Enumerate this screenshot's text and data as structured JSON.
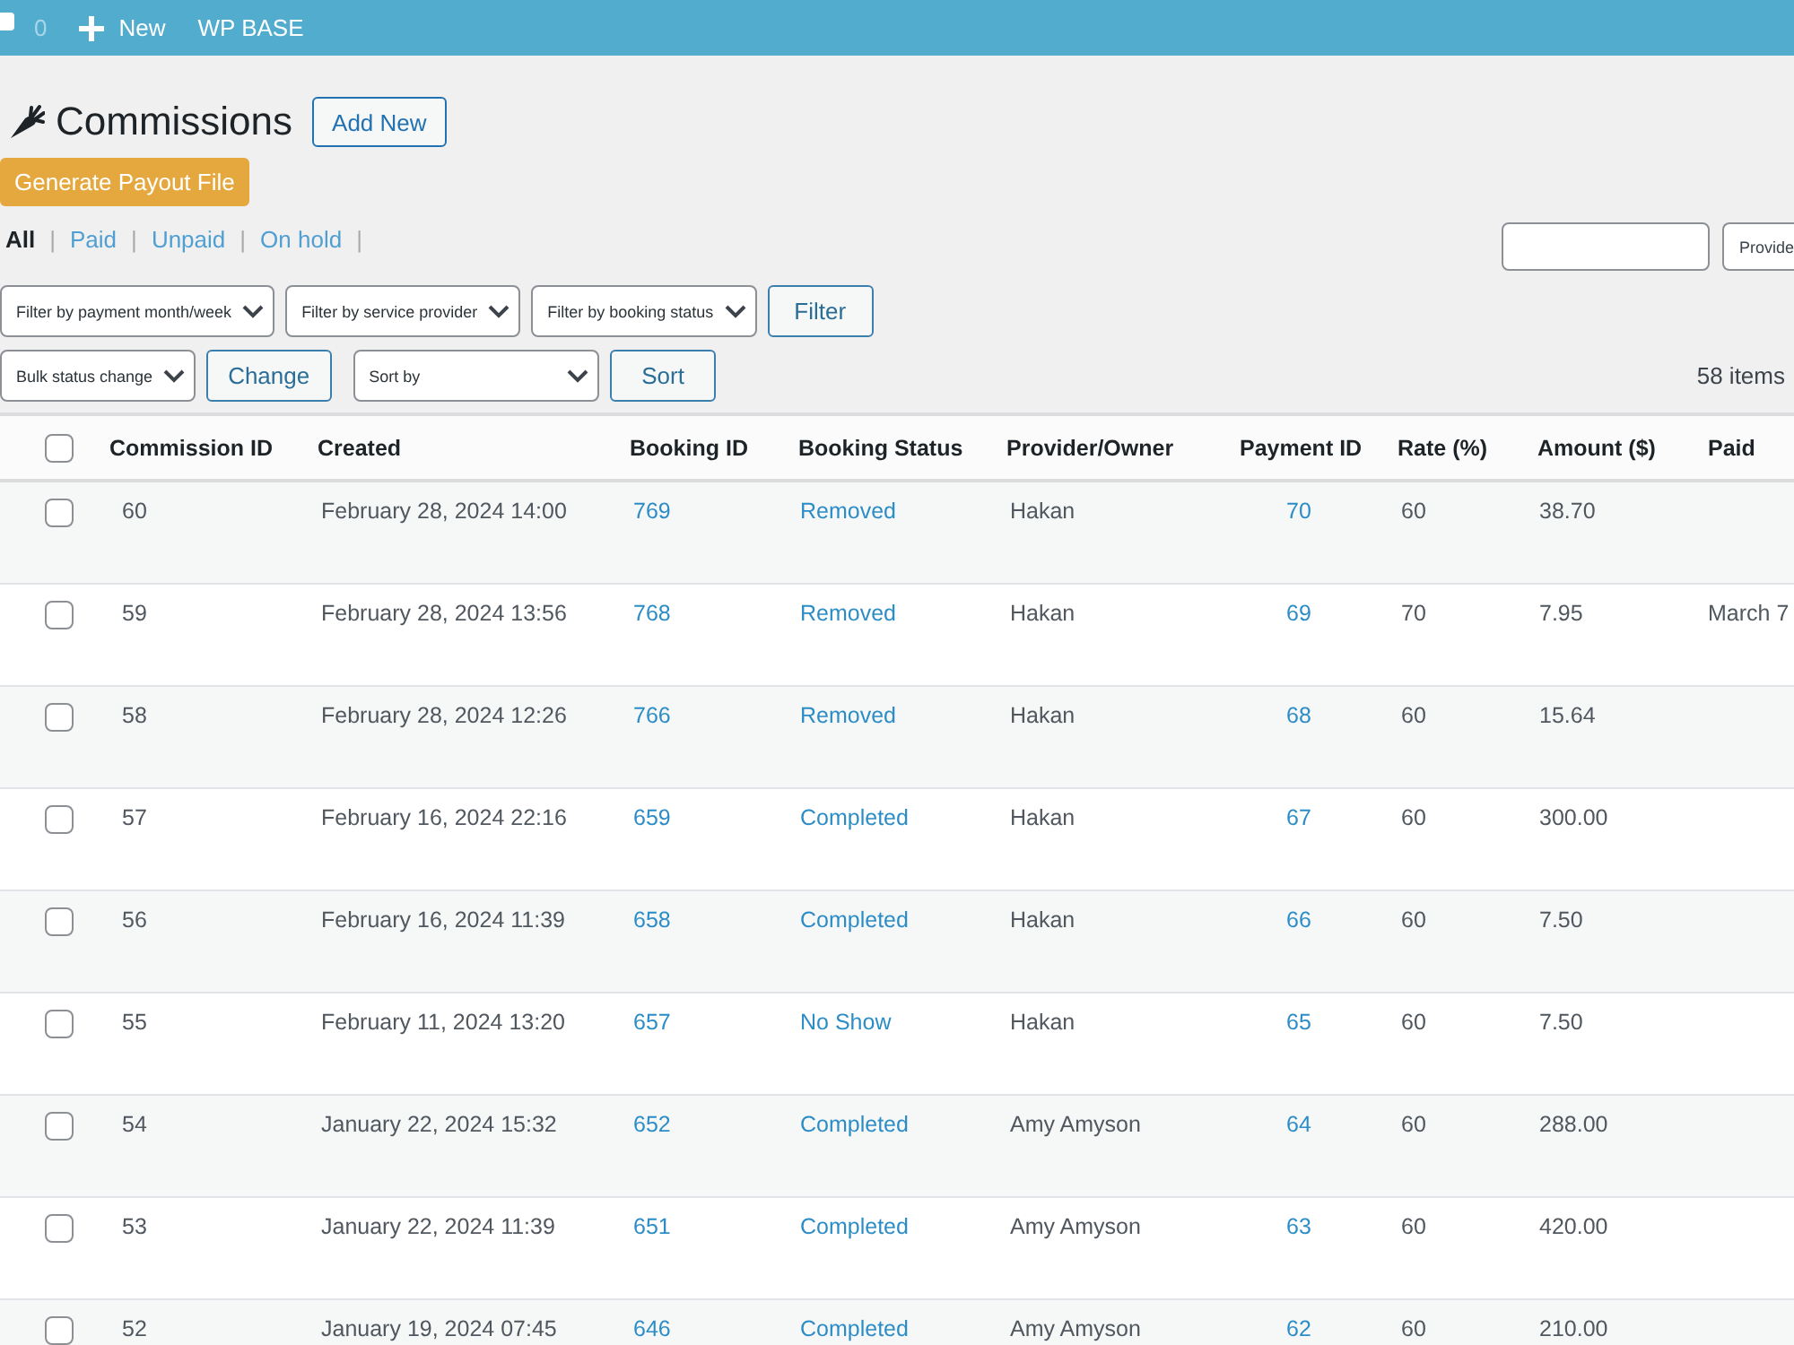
{
  "admin_bar": {
    "comments_count": "0",
    "new_label": "New",
    "site_name": "WP BASE"
  },
  "header": {
    "title": "Commissions",
    "add_new": "Add New",
    "generate_button": "Generate Payout File"
  },
  "views": [
    {
      "label": "All",
      "selected": true,
      "separator": "|"
    },
    {
      "label": "Paid",
      "selected": false,
      "separator": "|"
    },
    {
      "label": "Unpaid",
      "selected": false,
      "separator": "|"
    },
    {
      "label": "On hold",
      "selected": false,
      "separator": "|"
    }
  ],
  "search_box": {
    "provider_select": "Provide"
  },
  "filters": {
    "selects": [
      "Filter by payment month/week",
      "Filter by service provider",
      "Filter by booking status"
    ],
    "button": "Filter"
  },
  "actions": {
    "bulk_select": "Bulk status change",
    "bulk_button": "Change",
    "sort_select": "Sort by",
    "sort_button": "Sort",
    "item_count": "58 items"
  },
  "table": {
    "select_all": {
      "checked": false
    },
    "columns": [
      "Commission ID",
      "Created",
      "Booking ID",
      "Booking Status",
      "Provider/Owner",
      "Payment ID",
      "Rate (%)",
      "Amount ($)",
      "Paid"
    ],
    "rows": [
      {
        "checked": false,
        "commission_id": "60",
        "created": "February 28, 2024 14:00",
        "booking_id": "769",
        "booking_status": "Removed",
        "provider": "Hakan",
        "payment_id": "70",
        "rate": "60",
        "amount": "38.70"
      },
      {
        "checked": false,
        "commission_id": "59",
        "created": "February 28, 2024 13:56",
        "booking_id": "768",
        "booking_status": "Removed",
        "provider": "Hakan",
        "payment_id": "69",
        "rate": "70",
        "amount": "7.95",
        "paid": "March 7"
      },
      {
        "checked": false,
        "commission_id": "58",
        "created": "February 28, 2024 12:26",
        "booking_id": "766",
        "booking_status": "Removed",
        "provider": "Hakan",
        "payment_id": "68",
        "rate": "60",
        "amount": "15.64"
      },
      {
        "checked": false,
        "commission_id": "57",
        "created": "February 16, 2024 22:16",
        "booking_id": "659",
        "booking_status": "Completed",
        "provider": "Hakan",
        "payment_id": "67",
        "rate": "60",
        "amount": "300.00"
      },
      {
        "checked": false,
        "commission_id": "56",
        "created": "February 16, 2024 11:39",
        "booking_id": "658",
        "booking_status": "Completed",
        "provider": "Hakan",
        "payment_id": "66",
        "rate": "60",
        "amount": "7.50"
      },
      {
        "checked": false,
        "commission_id": "55",
        "created": "February 11, 2024 13:20",
        "booking_id": "657",
        "booking_status": "No Show",
        "provider": "Hakan",
        "payment_id": "65",
        "rate": "60",
        "amount": "7.50"
      },
      {
        "checked": false,
        "commission_id": "54",
        "created": "January 22, 2024 15:32",
        "booking_id": "652",
        "booking_status": "Completed",
        "provider": "Amy Amyson",
        "payment_id": "64",
        "rate": "60",
        "amount": "288.00"
      },
      {
        "checked": false,
        "commission_id": "53",
        "created": "January 22, 2024 11:39",
        "booking_id": "651",
        "booking_status": "Completed",
        "provider": "Amy Amyson",
        "payment_id": "63",
        "rate": "60",
        "amount": "420.00"
      },
      {
        "checked": false,
        "commission_id": "52",
        "created": "January 19, 2024 07:45",
        "booking_id": "646",
        "booking_status": "Completed",
        "provider": "Amy Amyson",
        "payment_id": "62",
        "rate": "60",
        "amount": "210.00"
      }
    ]
  }
}
